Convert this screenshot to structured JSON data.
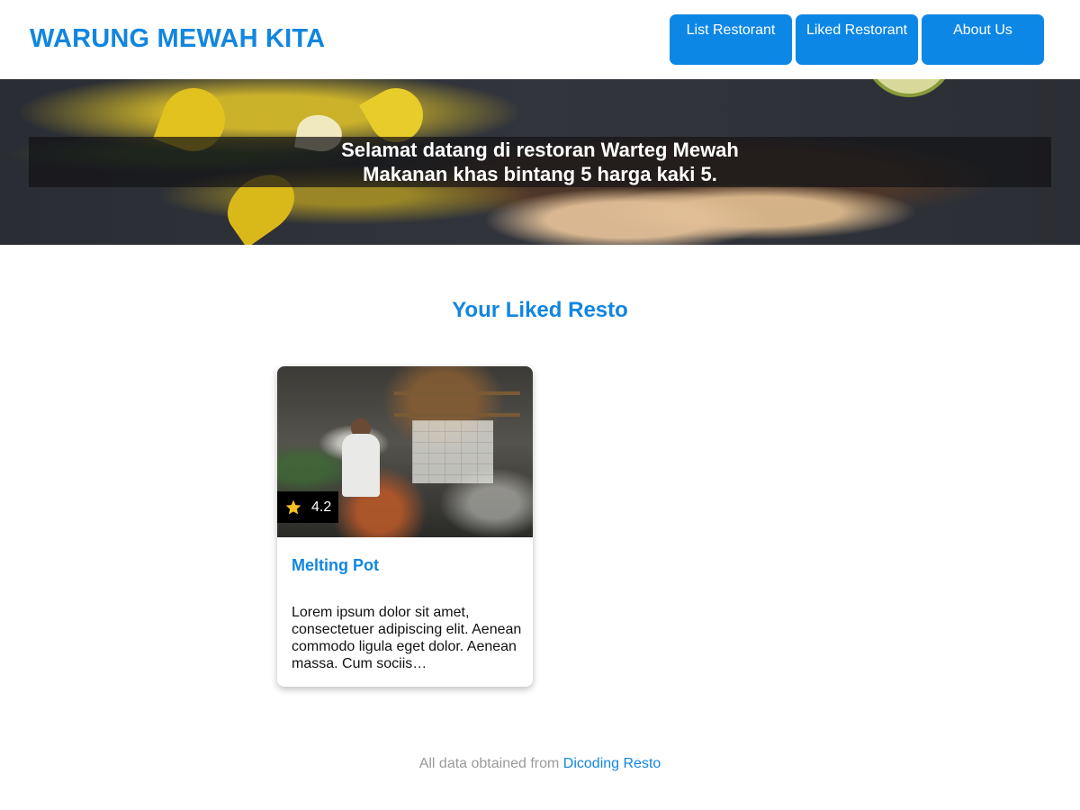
{
  "header": {
    "brand": "WARUNG MEWAH KITA",
    "nav": [
      "List Restorant",
      "Liked Restorant",
      "About Us"
    ]
  },
  "hero": {
    "line1": "Selamat datang di restoran Warteg Mewah",
    "line2": "Makanan khas bintang 5 harga kaki 5."
  },
  "main": {
    "title": "Your Liked Resto",
    "restaurants": [
      {
        "name": "Melting Pot",
        "rating": "4.2",
        "description": "Lorem ipsum dolor sit amet, consectetuer adipiscing elit. Aenean commodo ligula eget dolor. Aenean massa. Cum sociis…"
      }
    ]
  },
  "footer": {
    "text": "All data obtained from",
    "link_label": "Dicoding Resto"
  },
  "colors": {
    "accent": "#1186e0",
    "nav_button": "#0d87e6",
    "star": "#f7c21e"
  }
}
